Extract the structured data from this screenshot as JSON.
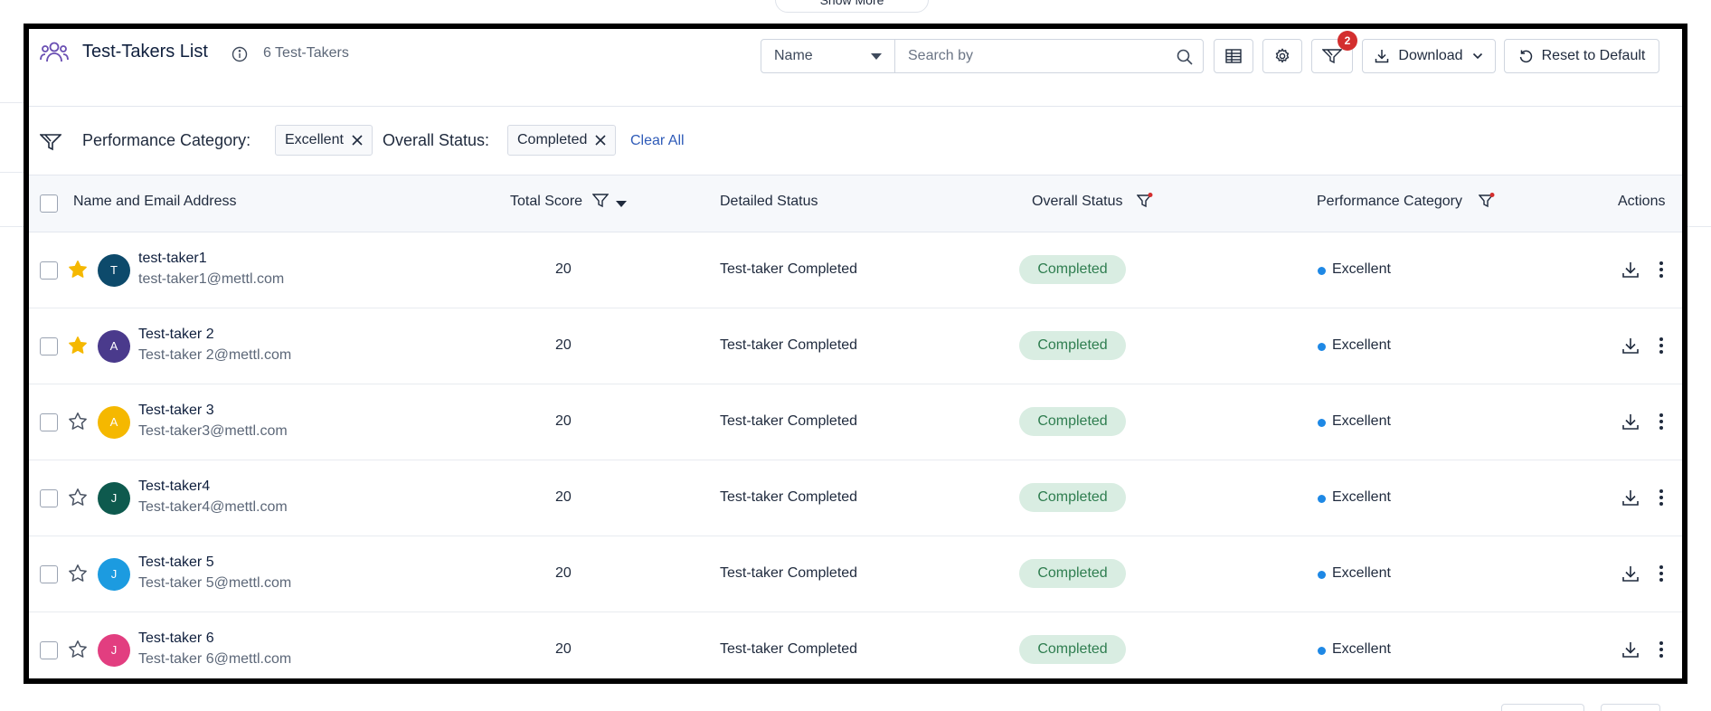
{
  "top_pill": {
    "label": "Show More"
  },
  "header": {
    "title": "Test-Takers List",
    "count": "6 Test-Takers",
    "search": {
      "select_value": "Name",
      "placeholder": "Search by"
    },
    "filter_badge": "2",
    "download_label": "Download",
    "reset_label": "Reset to Default"
  },
  "filters": {
    "items": [
      {
        "label": "Performance Category:",
        "chip": "Excellent"
      },
      {
        "label": "Overall Status:",
        "chip": "Completed"
      }
    ],
    "clear_all": "Clear All"
  },
  "table": {
    "columns": {
      "name": "Name and Email Address",
      "score": "Total Score",
      "detailed": "Detailed Status",
      "overall": "Overall Status",
      "performance": "Performance Category",
      "actions": "Actions"
    },
    "rows": [
      {
        "starred": true,
        "initial": "T",
        "avatar_color": "#0d4a6b",
        "name": "test-taker1",
        "email": "test-taker1@mettl.com",
        "score": "20",
        "detailed": "Test-taker Completed",
        "overall": "Completed",
        "performance": "Excellent"
      },
      {
        "starred": true,
        "initial": "A",
        "avatar_color": "#4a3a8c",
        "name": "Test-taker 2",
        "email": "Test-taker 2@mettl.com",
        "score": "20",
        "detailed": "Test-taker Completed",
        "overall": "Completed",
        "performance": "Excellent"
      },
      {
        "starred": false,
        "initial": "A",
        "avatar_color": "#f5b800",
        "name": "Test-taker 3",
        "email": "Test-taker3@mettl.com",
        "score": "20",
        "detailed": "Test-taker Completed",
        "overall": "Completed",
        "performance": "Excellent"
      },
      {
        "starred": false,
        "initial": "J",
        "avatar_color": "#0e5a4e",
        "name": "Test-taker4",
        "email": "Test-taker4@mettl.com",
        "score": "20",
        "detailed": "Test-taker Completed",
        "overall": "Completed",
        "performance": "Excellent"
      },
      {
        "starred": false,
        "initial": "J",
        "avatar_color": "#1c9be0",
        "name": "Test-taker 5",
        "email": "Test-taker 5@mettl.com",
        "score": "20",
        "detailed": "Test-taker Completed",
        "overall": "Completed",
        "performance": "Excellent"
      },
      {
        "starred": false,
        "initial": "J",
        "avatar_color": "#e23e80",
        "name": "Test-taker 6",
        "email": "Test-taker 6@mettl.com",
        "score": "20",
        "detailed": "Test-taker Completed",
        "overall": "Completed",
        "performance": "Excellent"
      }
    ]
  },
  "colors": {
    "star_filled": "#f5b800",
    "completed_pill_bg": "#d9ede2",
    "completed_pill_text": "#2e7d4f",
    "excellent_dot": "#1e88e5",
    "badge": "#d32f2f",
    "link": "#2f5bb8"
  },
  "icons": {
    "header": "users-icon",
    "info": "info-icon",
    "search": "search-icon",
    "columns": "columns-icon",
    "settings": "gear-icon",
    "filter": "filter-icon",
    "download": "download-icon",
    "reset": "reset-icon",
    "more": "more-vertical-icon"
  }
}
